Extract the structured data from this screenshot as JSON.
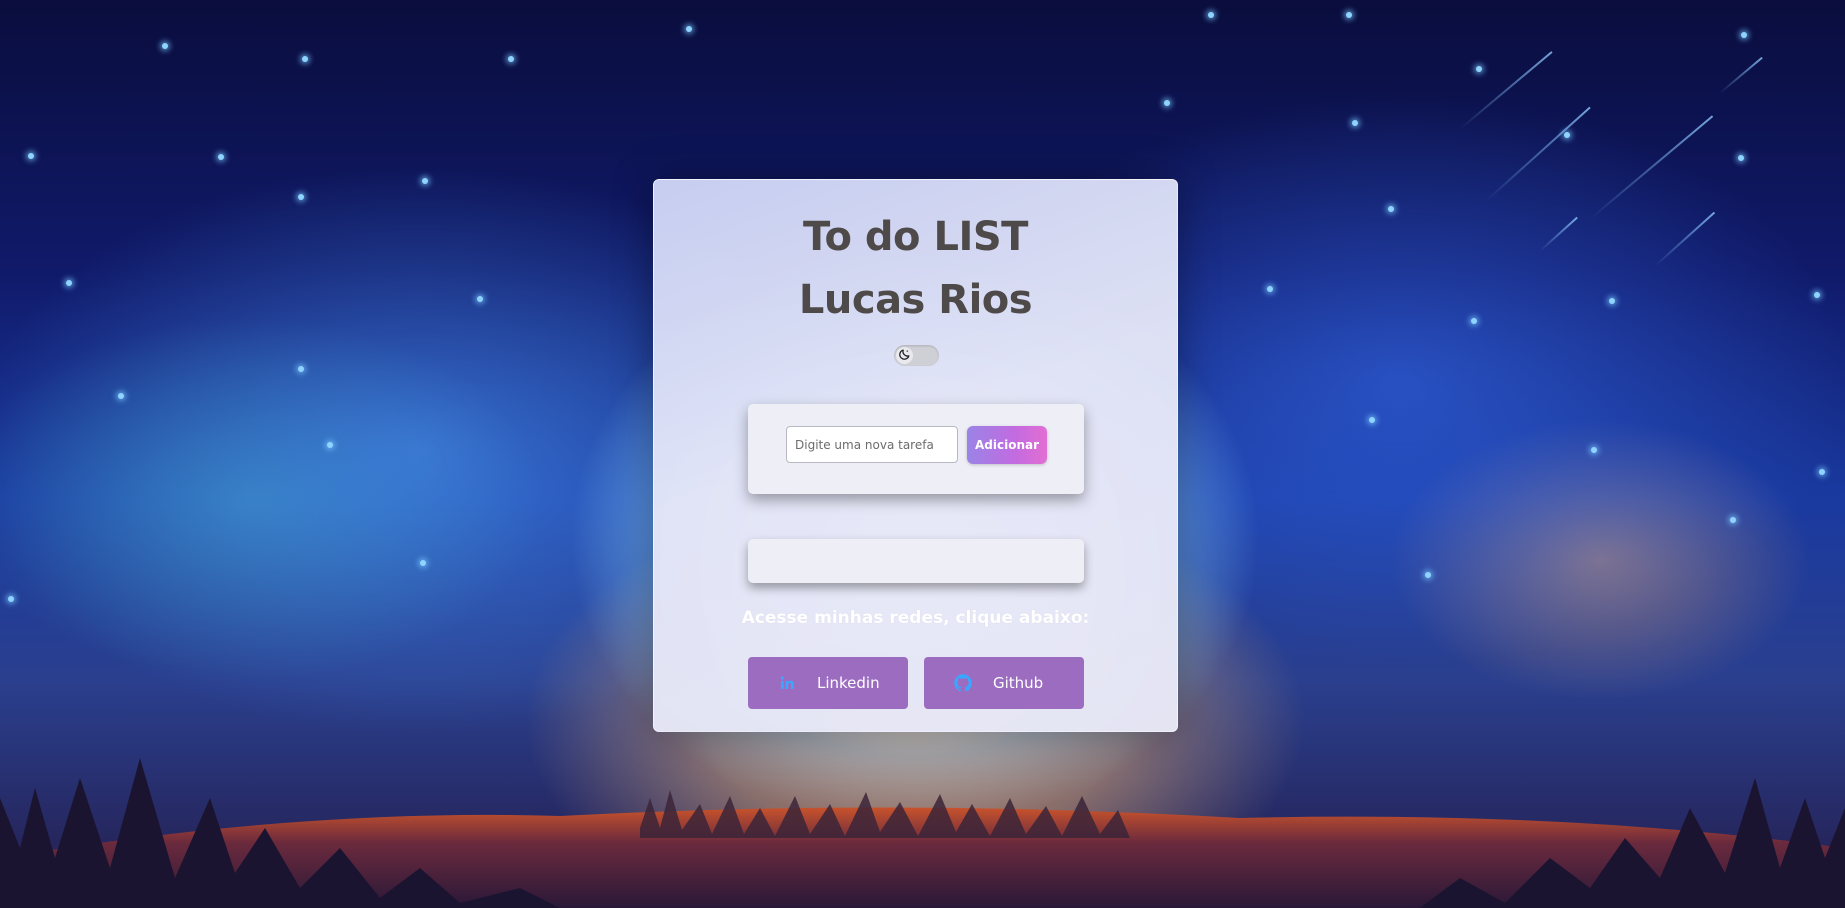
{
  "header": {
    "title_line1": "To do LIST",
    "title_line2": "Lucas Rios"
  },
  "theme_toggle": {
    "icon": "moon-icon",
    "state": "light"
  },
  "task_form": {
    "input_placeholder": "Digite uma nova tarefa",
    "input_value": "",
    "add_button_label": "Adicionar"
  },
  "task_list": {
    "items": []
  },
  "social": {
    "heading": "Acesse minhas redes, clique abaixo:",
    "links": [
      {
        "label": "Linkedin",
        "icon": "linkedin-icon",
        "icon_color": "#39a7ff"
      },
      {
        "label": "Github",
        "icon": "github-icon",
        "icon_color": "#39a7ff"
      }
    ]
  },
  "colors": {
    "accent_gradient_start": "#9a84e6",
    "accent_gradient_end": "#e26fd3",
    "social_button": "#9c6cc1",
    "title_text": "#4f4a4a"
  }
}
